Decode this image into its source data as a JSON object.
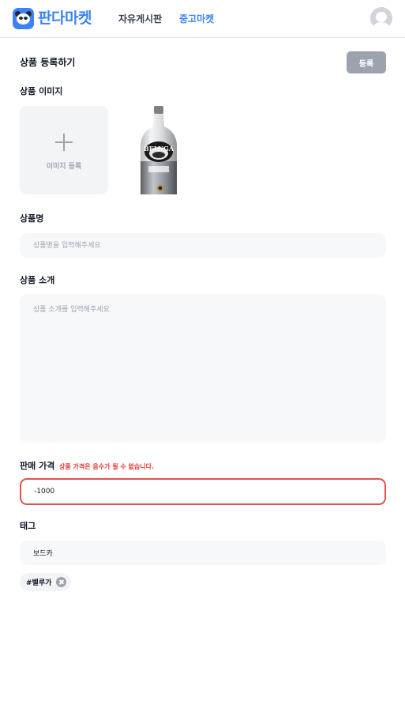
{
  "header": {
    "logo_text": "판다마켓",
    "nav": {
      "free_board": "자유게시판",
      "used_market": "중고마켓"
    },
    "active_nav": "used_market",
    "accent_color": "#3b82f6"
  },
  "form": {
    "title": "상품 등록하기",
    "submit_label": "등록",
    "submit_disabled": true,
    "image_section": {
      "label": "상품 이미지",
      "upload_label": "이미지 등록",
      "uploaded_image": "vodka-bottle"
    },
    "name_field": {
      "label": "상품명",
      "value": "",
      "placeholder": "상품명을 입력해주세요"
    },
    "description_field": {
      "label": "상품 소개",
      "value": "",
      "placeholder": "상품 소개를 입력해주세요"
    },
    "price_field": {
      "label": "판매 가격",
      "error": "상품 가격은 음수가 될 수 없습니다.",
      "value": "-1000",
      "error_color": "#e05252"
    },
    "tag_field": {
      "label": "태그",
      "value": "보드카",
      "tags": [
        "#벨루가"
      ]
    }
  }
}
